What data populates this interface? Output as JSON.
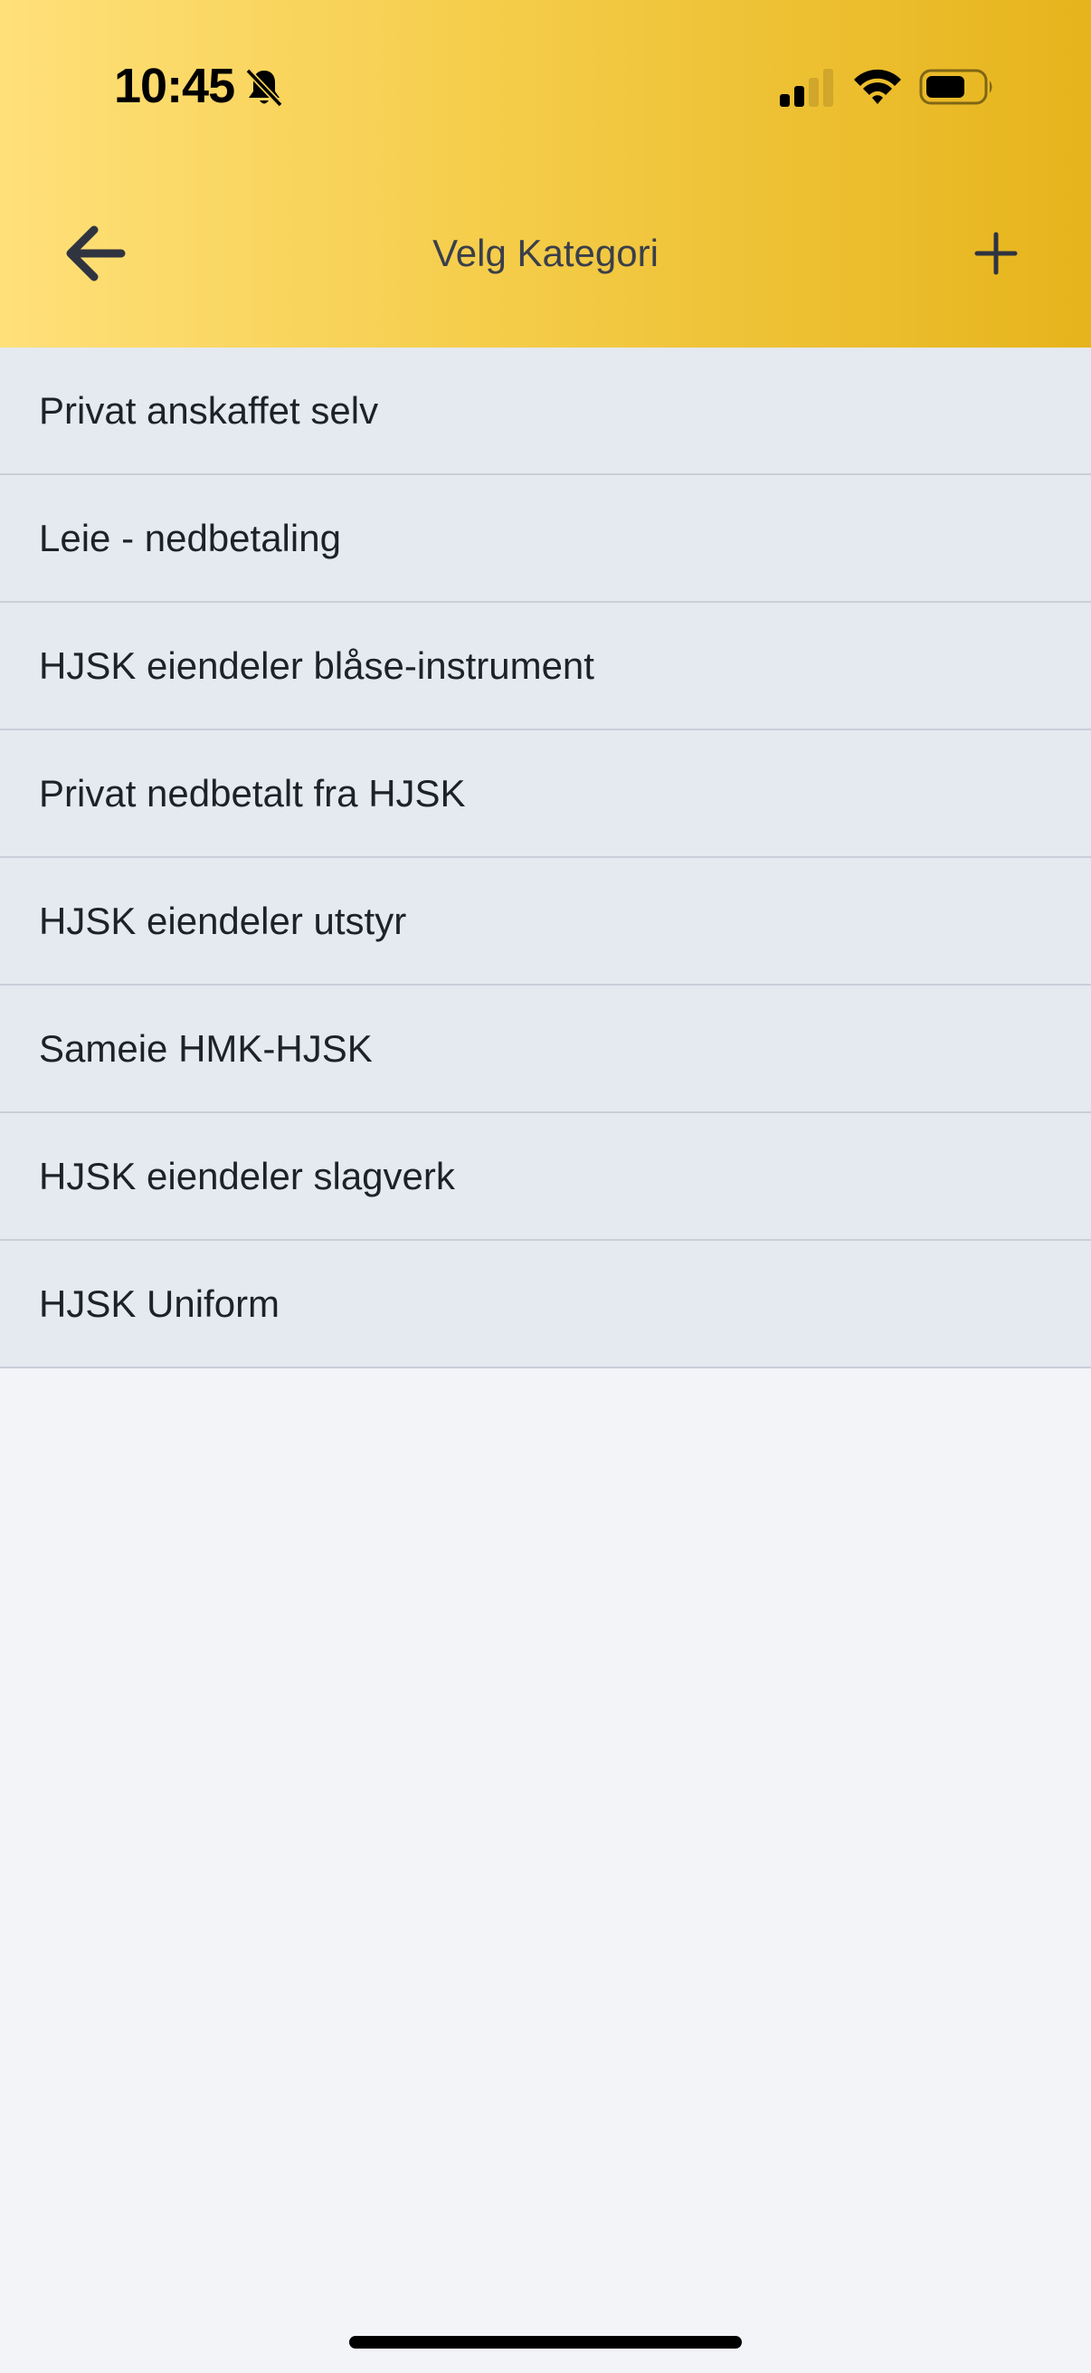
{
  "status_bar": {
    "time": "10:45",
    "icons": [
      "bell-slash-icon",
      "cellular-signal-icon",
      "wifi-icon",
      "battery-icon"
    ]
  },
  "nav": {
    "title": "Velg Kategori",
    "back_icon": "arrow-left-icon",
    "add_icon": "plus-icon"
  },
  "categories": [
    {
      "label": "Privat anskaffet selv"
    },
    {
      "label": "Leie - nedbetaling"
    },
    {
      "label": "HJSK eiendeler blåse-instrument"
    },
    {
      "label": "Privat nedbetalt fra HJSK"
    },
    {
      "label": "HJSK eiendeler utstyr"
    },
    {
      "label": "Sameie HMK-HJSK"
    },
    {
      "label": "HJSK eiendeler slagverk"
    },
    {
      "label": "HJSK Uniform"
    }
  ],
  "colors": {
    "header_gradient_start": "#ffe07a",
    "header_gradient_end": "#e6b41c",
    "list_background": "#e5e9f0",
    "page_background": "#f2f4f8",
    "text": "#1e2228"
  }
}
